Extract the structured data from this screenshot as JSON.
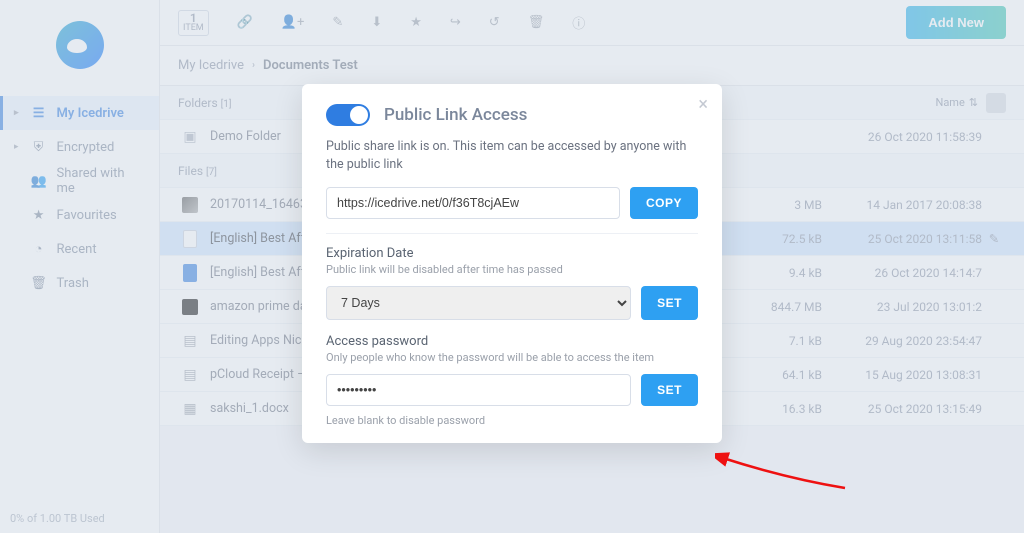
{
  "toolbar": {
    "item_count": "1",
    "item_label": "ITEM",
    "add_new": "Add New"
  },
  "breadcrumb": {
    "root": "My Icedrive",
    "current": "Documents Test"
  },
  "sidebar": {
    "items": [
      {
        "label": "My Icedrive"
      },
      {
        "label": "Encrypted"
      },
      {
        "label": "Shared with me"
      },
      {
        "label": "Favourites"
      },
      {
        "label": "Recent"
      },
      {
        "label": "Trash"
      }
    ]
  },
  "sections": {
    "folders_label": "Folders",
    "folders_count": "[1]",
    "files_label": "Files",
    "files_count": "[7]",
    "sort_label": "Name"
  },
  "folders": [
    {
      "name": "Demo Folder",
      "size": "",
      "date": "26 Oct 2020 11:58:39"
    }
  ],
  "files": [
    {
      "name": "20170114_164638.jpg",
      "size": "3 MB",
      "date": "14 Jan 2017 20:08:38",
      "icon": "img"
    },
    {
      "name": "[English] Best Affo…",
      "size": "72.5 kB",
      "date": "25 Oct 2020 13:11:58",
      "icon": "docblue",
      "selected": true
    },
    {
      "name": "[English] Best Affo…",
      "size": "9.4 kB",
      "date": "26 Oct 2020 14:14:7",
      "icon": "docblue"
    },
    {
      "name": "amazon prime da…",
      "size": "844.7 MB",
      "date": "23 Jul 2020 13:01:2",
      "icon": "dark"
    },
    {
      "name": "Editing Apps Nich…",
      "size": "7.1 kB",
      "date": "29 Aug 2020 23:54:47",
      "icon": "csv"
    },
    {
      "name": "pCloud Receipt – …",
      "size": "64.1 kB",
      "date": "15 Aug 2020 13:08:31",
      "icon": "csv"
    },
    {
      "name": "sakshi_1.docx",
      "size": "16.3 kB",
      "date": "25 Oct 2020 13:15:49",
      "icon": "docx"
    }
  ],
  "modal": {
    "title": "Public Link Access",
    "desc": "Public share link is on. This item can be accessed by anyone with the public link",
    "link_value": "https://icedrive.net/0/f36T8cjAEw",
    "copy": "COPY",
    "exp_label": "Expiration Date",
    "exp_hint": "Public link will be disabled after time has passed",
    "exp_value": "7 Days",
    "set": "SET",
    "pw_label": "Access password",
    "pw_hint": "Only people who know the password will be able to access the item",
    "pw_value": "•••••••••",
    "pw_blank_hint": "Leave blank to disable password"
  },
  "footer": {
    "usage": "0% of 1.00 TB Used"
  }
}
